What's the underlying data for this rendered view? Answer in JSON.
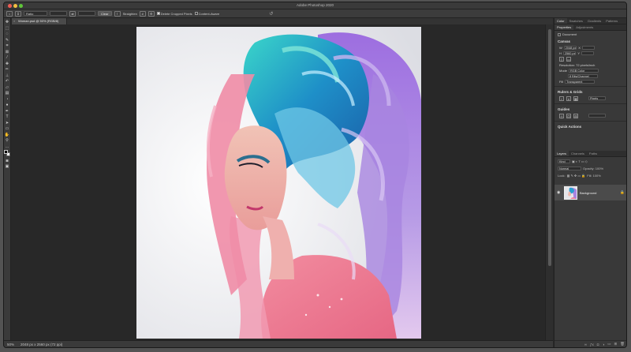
{
  "window": {
    "title": "Adobe Photoshop 2020"
  },
  "options_bar": {
    "ratio_select": "Ratio",
    "clear_label": "Clear",
    "straighten_label": "Straighten",
    "delete_cropped_label": "Delete Cropped Pixels",
    "delete_cropped_checked": true,
    "content_aware_label": "Content-Aware",
    "content_aware_checked": false
  },
  "document": {
    "tab_label": "Woman.psd @ 50% (RGB/8)"
  },
  "status": {
    "zoom": "50%",
    "info": "2048 px x 2560 px (72 ppi)"
  },
  "panels": {
    "top_tabs": [
      "Color",
      "Swatches",
      "Gradients",
      "Patterns"
    ],
    "sub_tabs": [
      "Properties",
      "Adjustments"
    ],
    "doc_label": "Document",
    "canvas_title": "Canvas",
    "width_label": "W",
    "width_value": "2048 px",
    "height_label": "H",
    "height_value": "2560 px",
    "x_label": "X",
    "y_label": "Y",
    "resolution": "Resolution: 72 pixels/inch",
    "mode_label": "Mode",
    "mode_value": "RGB Color",
    "depth_value": "8 Bits/Channel",
    "fill_label": "Fill",
    "fill_value": "Transparent",
    "rulers_title": "Rulers & Grids",
    "ruler_unit": "Pixels",
    "guides_title": "Guides",
    "quick_actions_title": "Quick Actions",
    "layer_tabs": [
      "Layers",
      "Channels",
      "Paths"
    ],
    "layer_kind": "Kind",
    "blend_mode": "Normal",
    "opacity_label": "Opacity: 100%",
    "lock_label": "Lock:",
    "fill_pct_label": "Fill: 100%",
    "layer_name": "Background"
  },
  "colors": {
    "accent": "#3a3a3a",
    "canvas": "#282828"
  }
}
